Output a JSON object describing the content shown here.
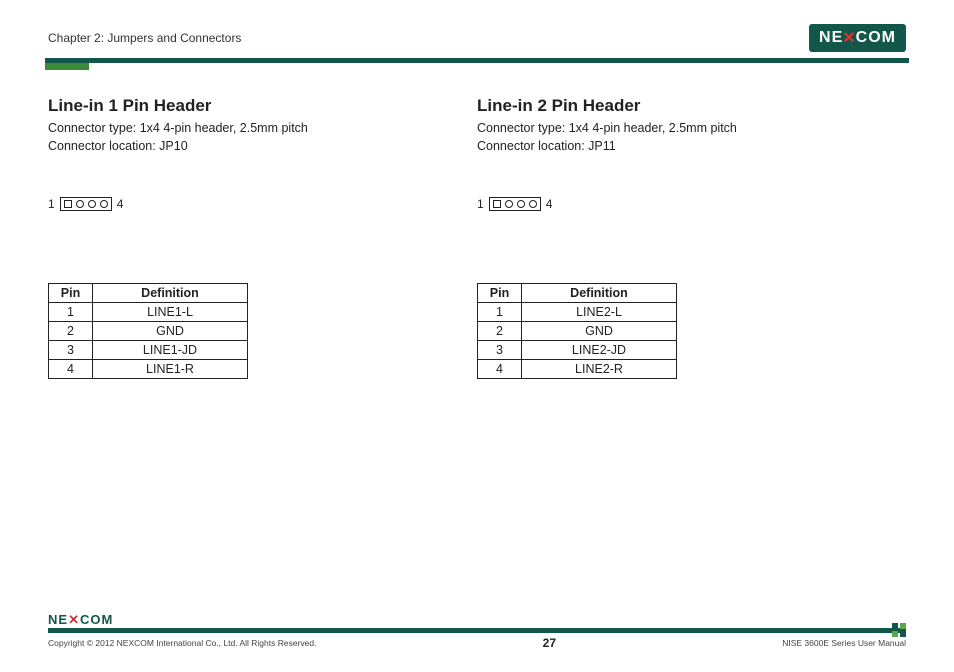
{
  "header": {
    "chapter": "Chapter 2: Jumpers and Connectors",
    "logo_text": "NE COM",
    "logo_x": "X"
  },
  "sections": [
    {
      "title": "Line-in 1 Pin Header",
      "connector_type": "Connector type: 1x4 4-pin header, 2.5mm pitch",
      "connector_location": "Connector location: JP10",
      "pin_start": "1",
      "pin_end": "4",
      "table": {
        "headers": {
          "pin": "Pin",
          "def": "Definition"
        },
        "rows": [
          {
            "pin": "1",
            "def": "LINE1-L"
          },
          {
            "pin": "2",
            "def": "GND"
          },
          {
            "pin": "3",
            "def": "LINE1-JD"
          },
          {
            "pin": "4",
            "def": "LINE1-R"
          }
        ]
      }
    },
    {
      "title": "Line-in 2 Pin Header",
      "connector_type": "Connector type: 1x4 4-pin header, 2.5mm pitch",
      "connector_location": "Connector location: JP11",
      "pin_start": "1",
      "pin_end": "4",
      "table": {
        "headers": {
          "pin": "Pin",
          "def": "Definition"
        },
        "rows": [
          {
            "pin": "1",
            "def": "LINE2-L"
          },
          {
            "pin": "2",
            "def": "GND"
          },
          {
            "pin": "3",
            "def": "LINE2-JD"
          },
          {
            "pin": "4",
            "def": "LINE2-R"
          }
        ]
      }
    }
  ],
  "footer": {
    "logo_text": "NEXCOM",
    "copyright": "Copyright © 2012 NEXCOM International Co., Ltd. All Rights Reserved.",
    "page": "27",
    "manual": "NISE 3600E Series User Manual"
  }
}
